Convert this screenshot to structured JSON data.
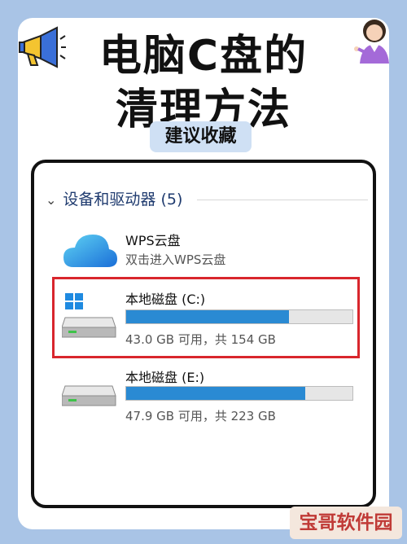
{
  "header": {
    "title_line1": "电脑C盘的",
    "title_line2": "清理方法",
    "tag": "建议收藏"
  },
  "explorer": {
    "group_header": "设备和驱动器 (5)",
    "items": [
      {
        "name": "WPS云盘",
        "subtitle": "双击进入WPS云盘",
        "icon": "cloud-icon"
      },
      {
        "name": "本地磁盘 (C:)",
        "usage_text": "43.0 GB 可用，共 154 GB",
        "used_fraction": 0.72,
        "icon": "windows-drive-icon"
      },
      {
        "name": "本地磁盘 (E:)",
        "usage_text": "47.9 GB 可用，共 223 GB",
        "used_fraction": 0.79,
        "icon": "drive-icon"
      }
    ]
  },
  "watermark": "宝哥软件园",
  "colors": {
    "page_bg": "#a9c4e6",
    "bar_fill": "#2a8ad3",
    "highlight": "#d9262d",
    "tag_bg": "#cfe0f4"
  }
}
